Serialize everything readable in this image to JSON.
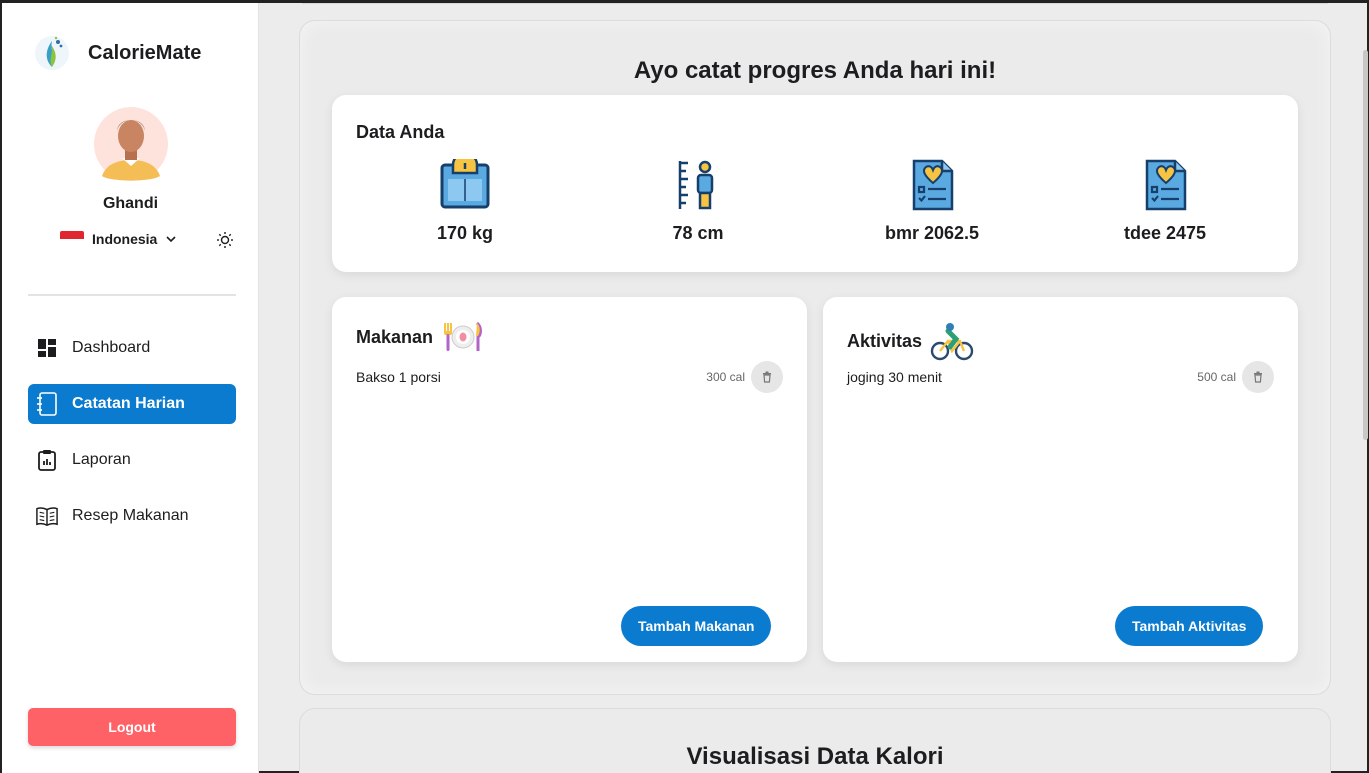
{
  "app": {
    "name": "CalorieMate"
  },
  "user": {
    "name": "Ghandi"
  },
  "language": {
    "selected": "Indonesia"
  },
  "nav": {
    "items": [
      {
        "label": "Dashboard",
        "icon": "dashboard-icon",
        "active": false
      },
      {
        "label": "Catatan Harian",
        "icon": "notebook-icon",
        "active": true
      },
      {
        "label": "Laporan",
        "icon": "clipboard-icon",
        "active": false
      },
      {
        "label": "Resep Makanan",
        "icon": "book-icon",
        "active": false
      }
    ],
    "logout_label": "Logout"
  },
  "main": {
    "heading": "Ayo catat progres Anda hari ini!",
    "data_card": {
      "title": "Data Anda",
      "stats": [
        {
          "icon": "scale-icon",
          "value": "170 kg"
        },
        {
          "icon": "height-ruler-icon",
          "value": "78 cm"
        },
        {
          "icon": "health-report-icon",
          "value": "bmr 2062.5"
        },
        {
          "icon": "health-report-icon",
          "value": "tdee 2475"
        }
      ]
    },
    "food": {
      "title": "Makanan",
      "entries": [
        {
          "name": "Bakso 1 porsi",
          "calories": "300 cal"
        }
      ],
      "add_label": "Tambah Makanan"
    },
    "activity": {
      "title": "Aktivitas",
      "entries": [
        {
          "name": "joging 30 menit",
          "calories": "500 cal"
        }
      ],
      "add_label": "Tambah Aktivitas"
    },
    "section2_heading": "Visualisasi Data Kalori"
  },
  "colors": {
    "primary": "#0a7bcf",
    "logout": "#ff6266",
    "background": "#ececec"
  }
}
